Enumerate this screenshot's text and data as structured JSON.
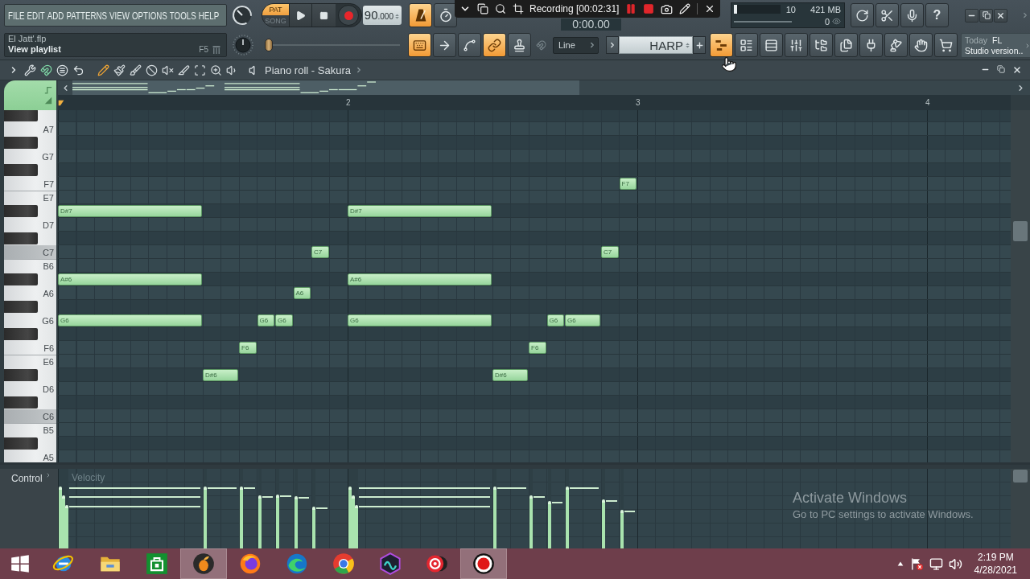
{
  "menu": [
    "FILE",
    "EDIT",
    "ADD",
    "PATTERNS",
    "VIEW",
    "OPTIONS",
    "TOOLS",
    "HELP"
  ],
  "project": {
    "file": "El Jatt'.flp",
    "hint": "View playlist",
    "shortcut": "F5"
  },
  "transport": {
    "modes": [
      {
        "label": "PAT",
        "selected": true
      },
      {
        "label": "SONG",
        "selected": false
      }
    ],
    "tempo": {
      "whole": "90",
      "fraction": ".000"
    },
    "position": {
      "level": 0
    }
  },
  "toolbar_top": [
    {
      "kind": "metronome",
      "on": true
    },
    {
      "kind": "countdown",
      "on": false
    }
  ],
  "toolbar_bottom": [
    {
      "kind": "typing-keyboard",
      "on": true
    },
    {
      "kind": "step-edit",
      "on": false
    },
    {
      "kind": "blend",
      "on": false
    },
    {
      "kind": "multilink",
      "on": true
    },
    {
      "kind": "stamp",
      "on": false
    }
  ],
  "recorder": {
    "label": "Recording [00:02:31]"
  },
  "time_display": "0:00.00",
  "monitor": {
    "cpu": "10",
    "memory": "421 MB",
    "polyphony": "0",
    "cpu_meter": {
      "level": 0.07
    }
  },
  "help": "?",
  "snap": "Line",
  "preset": "HARP",
  "windows": [
    {
      "kind": "piano-roll",
      "on": true
    },
    {
      "kind": "channel-rack",
      "on": false
    },
    {
      "kind": "playlist",
      "on": false
    },
    {
      "kind": "mixer",
      "on": false
    },
    {
      "kind": "browser",
      "on": false
    },
    {
      "kind": "plugin-picker",
      "on": false
    },
    {
      "kind": "plugin-database",
      "on": false
    },
    {
      "kind": "tutorial",
      "on": false
    },
    {
      "kind": "touch",
      "on": false
    },
    {
      "kind": "shop",
      "on": false
    }
  ],
  "news": {
    "date": "Today",
    "headline": "FL Studio version.."
  },
  "piano_roll": {
    "title": "Piano roll - Sakura",
    "snap_on": true,
    "tools": [
      {
        "kind": "pencil",
        "selected": true
      },
      {
        "kind": "brush",
        "selected": false
      },
      {
        "kind": "brush-add",
        "selected": false
      },
      {
        "kind": "delete",
        "selected": false
      },
      {
        "kind": "mute",
        "selected": false
      },
      {
        "kind": "slice",
        "selected": false
      },
      {
        "kind": "select",
        "selected": false
      },
      {
        "kind": "zoom",
        "selected": false
      },
      {
        "kind": "playback",
        "selected": false
      }
    ],
    "bars": [
      "2",
      "3",
      "4"
    ],
    "rows": [
      {
        "kind": "black",
        "shaded": false
      },
      {
        "kind": "white",
        "label": "A7",
        "shaded": false
      },
      {
        "kind": "black",
        "shaded": false
      },
      {
        "kind": "white",
        "label": "G7",
        "shaded": false
      },
      {
        "kind": "black",
        "shaded": false
      },
      {
        "kind": "white",
        "label": "F7",
        "shaded": false,
        "steps": [
          {
            "kind": "rest"
          },
          {
            "kind": "rest"
          },
          {
            "kind": "rest"
          },
          {
            "kind": "rest"
          },
          {
            "kind": "rest"
          },
          {
            "kind": "rest"
          },
          {
            "kind": "rest"
          },
          {
            "kind": "rest"
          },
          {
            "kind": "rest"
          },
          {
            "kind": "rest"
          },
          {
            "kind": "rest"
          },
          {
            "kind": "rest"
          },
          {
            "kind": "rest"
          },
          {
            "kind": "rest"
          },
          {
            "kind": "rest"
          },
          {
            "kind": "rest"
          },
          {
            "kind": "rest"
          },
          {
            "kind": "rest"
          },
          {
            "kind": "rest"
          },
          {
            "kind": "rest"
          },
          {
            "kind": "rest"
          },
          {
            "kind": "rest"
          },
          {
            "kind": "rest"
          },
          {
            "kind": "rest"
          },
          {
            "kind": "rest"
          },
          {
            "kind": "rest"
          },
          {
            "kind": "rest"
          },
          {
            "kind": "rest"
          },
          {
            "kind": "rest"
          },
          {
            "kind": "rest"
          },
          {
            "kind": "rest"
          },
          {
            "kind": "note",
            "label": "F7",
            "level": 0.49
          }
        ]
      },
      {
        "kind": "white",
        "label": "E7",
        "shaded": false
      },
      {
        "kind": "black",
        "shaded": false,
        "steps": [
          {
            "kind": "note",
            "label": "D#7",
            "level": 0.55
          },
          {
            "kind": "hold"
          },
          {
            "kind": "hold"
          },
          {
            "kind": "hold"
          },
          {
            "kind": "hold"
          },
          {
            "kind": "hold"
          },
          {
            "kind": "hold"
          },
          {
            "kind": "hold"
          },
          {
            "kind": "rest"
          },
          {
            "kind": "rest"
          },
          {
            "kind": "rest"
          },
          {
            "kind": "rest"
          },
          {
            "kind": "rest"
          },
          {
            "kind": "rest"
          },
          {
            "kind": "rest"
          },
          {
            "kind": "rest"
          },
          {
            "kind": "note",
            "label": "D#7",
            "level": 0.55
          },
          {
            "kind": "hold"
          },
          {
            "kind": "hold"
          },
          {
            "kind": "hold"
          },
          {
            "kind": "hold"
          },
          {
            "kind": "hold"
          },
          {
            "kind": "hold"
          },
          {
            "kind": "hold"
          }
        ]
      },
      {
        "kind": "white",
        "label": "D7",
        "shaded": false
      },
      {
        "kind": "black",
        "shaded": false
      },
      {
        "kind": "white",
        "label": "C7",
        "shaded": true,
        "steps": [
          {
            "kind": "rest"
          },
          {
            "kind": "rest"
          },
          {
            "kind": "rest"
          },
          {
            "kind": "rest"
          },
          {
            "kind": "rest"
          },
          {
            "kind": "rest"
          },
          {
            "kind": "rest"
          },
          {
            "kind": "rest"
          },
          {
            "kind": "rest"
          },
          {
            "kind": "rest"
          },
          {
            "kind": "rest"
          },
          {
            "kind": "rest"
          },
          {
            "kind": "rest"
          },
          {
            "kind": "rest"
          },
          {
            "kind": "note",
            "label": "C7",
            "level": 0.53
          },
          {
            "kind": "rest"
          },
          {
            "kind": "rest"
          },
          {
            "kind": "rest"
          },
          {
            "kind": "rest"
          },
          {
            "kind": "rest"
          },
          {
            "kind": "rest"
          },
          {
            "kind": "rest"
          },
          {
            "kind": "rest"
          },
          {
            "kind": "rest"
          },
          {
            "kind": "rest"
          },
          {
            "kind": "rest"
          },
          {
            "kind": "rest"
          },
          {
            "kind": "rest"
          },
          {
            "kind": "rest"
          },
          {
            "kind": "rest"
          },
          {
            "kind": "note",
            "label": "C7",
            "level": 0.62
          }
        ]
      },
      {
        "kind": "white",
        "label": "B6",
        "shaded": false
      },
      {
        "kind": "black",
        "shaded": false,
        "steps": [
          {
            "kind": "note",
            "label": "A#6",
            "level": 0.67
          },
          {
            "kind": "hold"
          },
          {
            "kind": "hold"
          },
          {
            "kind": "hold"
          },
          {
            "kind": "hold"
          },
          {
            "kind": "hold"
          },
          {
            "kind": "hold"
          },
          {
            "kind": "hold"
          },
          {
            "kind": "rest"
          },
          {
            "kind": "rest"
          },
          {
            "kind": "rest"
          },
          {
            "kind": "rest"
          },
          {
            "kind": "rest"
          },
          {
            "kind": "rest"
          },
          {
            "kind": "rest"
          },
          {
            "kind": "rest"
          },
          {
            "kind": "note",
            "label": "A#6",
            "level": 0.67
          },
          {
            "kind": "hold"
          },
          {
            "kind": "hold"
          },
          {
            "kind": "hold"
          },
          {
            "kind": "hold"
          },
          {
            "kind": "hold"
          },
          {
            "kind": "hold"
          },
          {
            "kind": "hold"
          }
        ]
      },
      {
        "kind": "white",
        "label": "A6",
        "shaded": false,
        "steps": [
          {
            "kind": "rest"
          },
          {
            "kind": "rest"
          },
          {
            "kind": "rest"
          },
          {
            "kind": "rest"
          },
          {
            "kind": "rest"
          },
          {
            "kind": "rest"
          },
          {
            "kind": "rest"
          },
          {
            "kind": "rest"
          },
          {
            "kind": "rest"
          },
          {
            "kind": "rest"
          },
          {
            "kind": "rest"
          },
          {
            "kind": "rest"
          },
          {
            "kind": "rest"
          },
          {
            "kind": "note",
            "label": "A6",
            "level": 0.66
          }
        ]
      },
      {
        "kind": "black",
        "shaded": false
      },
      {
        "kind": "white",
        "label": "G6",
        "shaded": false,
        "steps": [
          {
            "kind": "note",
            "label": "G6",
            "level": 0.78
          },
          {
            "kind": "hold"
          },
          {
            "kind": "hold"
          },
          {
            "kind": "hold"
          },
          {
            "kind": "hold"
          },
          {
            "kind": "hold"
          },
          {
            "kind": "hold"
          },
          {
            "kind": "hold"
          },
          {
            "kind": "rest"
          },
          {
            "kind": "rest"
          },
          {
            "kind": "rest"
          },
          {
            "kind": "note",
            "label": "G6",
            "level": 0.67
          },
          {
            "kind": "note",
            "label": "G6",
            "level": 0.68
          },
          {
            "kind": "rest"
          },
          {
            "kind": "rest"
          },
          {
            "kind": "rest"
          },
          {
            "kind": "note",
            "label": "G6",
            "level": 0.78
          },
          {
            "kind": "hold"
          },
          {
            "kind": "hold"
          },
          {
            "kind": "hold"
          },
          {
            "kind": "hold"
          },
          {
            "kind": "hold"
          },
          {
            "kind": "hold"
          },
          {
            "kind": "hold"
          },
          {
            "kind": "rest"
          },
          {
            "kind": "rest"
          },
          {
            "kind": "rest"
          },
          {
            "kind": "note",
            "label": "G6",
            "level": 0.6
          },
          {
            "kind": "note",
            "label": "G6",
            "level": 0.78
          },
          {
            "kind": "hold"
          }
        ]
      },
      {
        "kind": "black",
        "shaded": false
      },
      {
        "kind": "white",
        "label": "F6",
        "shaded": false,
        "steps": [
          {
            "kind": "rest"
          },
          {
            "kind": "rest"
          },
          {
            "kind": "rest"
          },
          {
            "kind": "rest"
          },
          {
            "kind": "rest"
          },
          {
            "kind": "rest"
          },
          {
            "kind": "rest"
          },
          {
            "kind": "rest"
          },
          {
            "kind": "rest"
          },
          {
            "kind": "rest"
          },
          {
            "kind": "note",
            "label": "F6",
            "level": 0.78
          },
          {
            "kind": "rest"
          },
          {
            "kind": "rest"
          },
          {
            "kind": "rest"
          },
          {
            "kind": "rest"
          },
          {
            "kind": "rest"
          },
          {
            "kind": "rest"
          },
          {
            "kind": "rest"
          },
          {
            "kind": "rest"
          },
          {
            "kind": "rest"
          },
          {
            "kind": "rest"
          },
          {
            "kind": "rest"
          },
          {
            "kind": "rest"
          },
          {
            "kind": "rest"
          },
          {
            "kind": "rest"
          },
          {
            "kind": "rest"
          },
          {
            "kind": "note",
            "label": "F6",
            "level": 0.67
          }
        ]
      },
      {
        "kind": "white",
        "label": "E6",
        "shaded": false
      },
      {
        "kind": "black",
        "shaded": false,
        "steps": [
          {
            "kind": "rest"
          },
          {
            "kind": "rest"
          },
          {
            "kind": "rest"
          },
          {
            "kind": "rest"
          },
          {
            "kind": "rest"
          },
          {
            "kind": "rest"
          },
          {
            "kind": "rest"
          },
          {
            "kind": "rest"
          },
          {
            "kind": "note",
            "label": "D#6",
            "level": 0.78
          },
          {
            "kind": "hold"
          },
          {
            "kind": "rest"
          },
          {
            "kind": "rest"
          },
          {
            "kind": "rest"
          },
          {
            "kind": "rest"
          },
          {
            "kind": "rest"
          },
          {
            "kind": "rest"
          },
          {
            "kind": "rest"
          },
          {
            "kind": "rest"
          },
          {
            "kind": "rest"
          },
          {
            "kind": "rest"
          },
          {
            "kind": "rest"
          },
          {
            "kind": "rest"
          },
          {
            "kind": "rest"
          },
          {
            "kind": "rest"
          },
          {
            "kind": "note",
            "label": "D#6",
            "level": 0.78
          },
          {
            "kind": "hold"
          }
        ]
      },
      {
        "kind": "white",
        "label": "D6",
        "shaded": false
      },
      {
        "kind": "black",
        "shaded": false
      },
      {
        "kind": "white",
        "label": "C6",
        "shaded": true
      },
      {
        "kind": "white",
        "label": "B5",
        "shaded": false
      },
      {
        "kind": "black",
        "shaded": false
      },
      {
        "kind": "white",
        "label": "A5",
        "shaded": false
      }
    ],
    "control": {
      "label": "Control",
      "target": "Velocity"
    }
  },
  "activation": {
    "title": "Activate Windows",
    "text": "Go to PC settings to activate Windows."
  },
  "taskbar": {
    "apps": [
      {
        "kind": "ie",
        "selected": false
      },
      {
        "kind": "explorer",
        "selected": false
      },
      {
        "kind": "store",
        "selected": false
      },
      {
        "kind": "fl",
        "selected": true
      },
      {
        "kind": "firefox",
        "selected": false
      },
      {
        "kind": "edge",
        "selected": false
      },
      {
        "kind": "chrome",
        "selected": false
      },
      {
        "kind": "nox",
        "selected": false
      },
      {
        "kind": "music",
        "selected": false
      },
      {
        "kind": "recorder",
        "selected": true
      }
    ],
    "time": "2:19 PM",
    "date": "4/28/2021"
  }
}
